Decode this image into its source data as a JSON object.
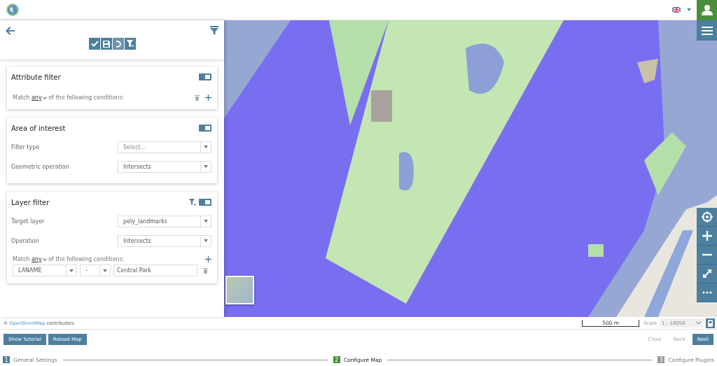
{
  "header": {
    "language_menu": {
      "expanded": false
    }
  },
  "filter_panel": {
    "sections": [
      {
        "kind": "attribute",
        "title": "Attribute filter",
        "enabled": true,
        "match": {
          "prefix": "Match",
          "value": "any",
          "suffix": "of the following conditions:"
        }
      },
      {
        "kind": "area",
        "title": "Area of interest",
        "enabled": true,
        "fields": [
          {
            "label": "Filter type",
            "placeholder": "Select..."
          },
          {
            "label": "Geometric operation",
            "value": "Intersects"
          }
        ]
      },
      {
        "kind": "layer",
        "title": "Layer filter",
        "enabled": true,
        "fields": [
          {
            "label": "Target layer",
            "value": "poly_landmarks"
          },
          {
            "label": "Operation",
            "value": "Intersects"
          }
        ],
        "match": {
          "prefix": "Match",
          "value": "any",
          "suffix": "of the following conditions:"
        },
        "conditions": [
          {
            "attribute": "LANAME",
            "operator": "-",
            "value": "Central Park"
          }
        ]
      }
    ]
  },
  "attribution": {
    "symbol": "©",
    "link": "OpenStreetMap",
    "text": "contributors"
  },
  "scale": {
    "bar": "500 m",
    "label": "Scale",
    "value": "1 : 18056"
  },
  "actions": [
    {
      "label": "Show Tutorial"
    },
    {
      "label": "Reload Map"
    }
  ],
  "navigation": [
    {
      "label": "Close",
      "disabled": true
    },
    {
      "label": "Back",
      "disabled": true
    },
    {
      "label": "Next",
      "disabled": false
    }
  ],
  "steps": [
    {
      "number": "1",
      "label": "General Settings",
      "completed": true,
      "selected": false
    },
    {
      "number": "2",
      "label": "Configure Map",
      "completed": false,
      "selected": true
    },
    {
      "number": "3",
      "label": "Configure Plugins",
      "completed": false,
      "selected": false
    }
  ]
}
